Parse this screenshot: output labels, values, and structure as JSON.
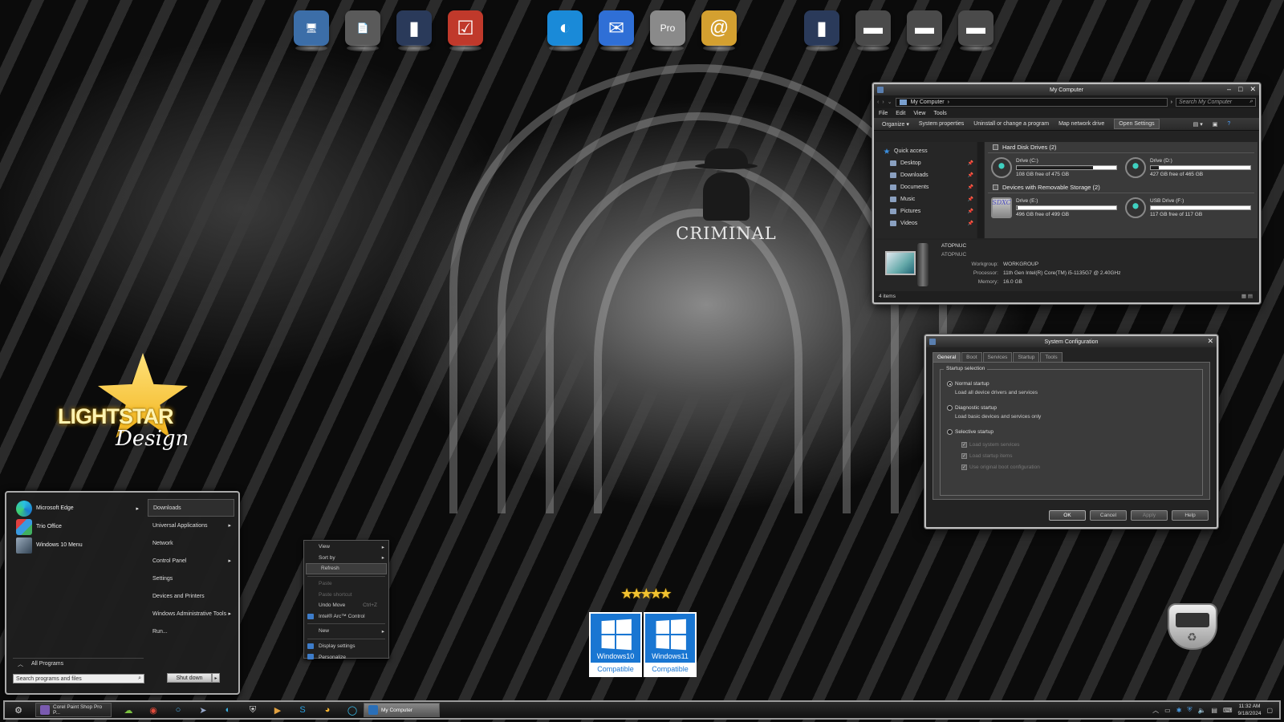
{
  "wallpaper": {
    "center_logo_text": "CRIMINAL",
    "brand_line1": "LIGHTSTAR",
    "brand_line2": "Design"
  },
  "dock": {
    "icons": [
      {
        "name": "my-computer-icon",
        "glyph": "🖥",
        "color": "#3c6ea8"
      },
      {
        "name": "documents-icon",
        "glyph": "📄",
        "color": "#5a5a5a"
      },
      {
        "name": "system-tower-icon",
        "glyph": "▮",
        "color": "#2a3a5a"
      },
      {
        "name": "checklist-icon",
        "glyph": "☑",
        "color": "#c0392b"
      },
      {
        "name": "edge-icon",
        "glyph": "◐",
        "color": "#1a8ad8"
      },
      {
        "name": "thunderbird-icon",
        "glyph": "✉",
        "color": "#2f6fd6"
      },
      {
        "name": "google-earth-pro-icon",
        "glyph": "Pro",
        "color": "#8a8a8a"
      },
      {
        "name": "address-book-icon",
        "glyph": "@",
        "color": "#d4a030"
      },
      {
        "name": "system-tower-2-icon",
        "glyph": "▮",
        "color": "#2a3a5a"
      },
      {
        "name": "folder-icon",
        "glyph": "▬",
        "color": "#4a4a4a"
      },
      {
        "name": "folder-2-icon",
        "glyph": "▬",
        "color": "#4a4a4a"
      },
      {
        "name": "folder-3-icon",
        "glyph": "▬",
        "color": "#4a4a4a"
      }
    ]
  },
  "mycomputer": {
    "title": "My Computer",
    "address": "My Computer",
    "search_placeholder": "Search My Computer",
    "menu": [
      "File",
      "Edit",
      "View",
      "Tools"
    ],
    "commands": [
      "Organize",
      "System properties",
      "Uninstall or change a program",
      "Map network drive",
      "Open Settings"
    ],
    "nav": {
      "quick_access": "Quick access",
      "items": [
        "Desktop",
        "Downloads",
        "Documents",
        "Music",
        "Pictures",
        "Videos"
      ]
    },
    "groups": {
      "hdd": "Hard Disk Drives (2)",
      "removable": "Devices with Removable Storage (2)"
    },
    "drives": [
      {
        "name": "Drive (C:)",
        "info": "108 GB free of 475 GB",
        "used": 0.77
      },
      {
        "name": "Drive (D:)",
        "info": "427 GB free of 465 GB",
        "used": 0.08
      },
      {
        "name": "Drive (E:)",
        "info": "496 GB free of 499 GB",
        "used": 0.01,
        "badge": "SDXC"
      },
      {
        "name": "USB Drive (F:)",
        "info": "117 GB free of 117 GB",
        "used": 0.0
      }
    ],
    "details": {
      "name1": "ATOPNUC",
      "name2": "ATOPNUC",
      "workgroup_label": "Workgroup:",
      "workgroup": "WORKGROUP",
      "processor_label": "Processor:",
      "processor": "11th Gen Intel(R) Core(TM) i5-1135G7 @ 2.40GHz",
      "memory_label": "Memory:",
      "memory": "16.0 GB"
    },
    "status": "4 items"
  },
  "msconfig": {
    "title": "System Configuration",
    "tabs": [
      "General",
      "Boot",
      "Services",
      "Startup",
      "Tools"
    ],
    "legend": "Startup selection",
    "normal": "Normal startup",
    "normal_desc": "Load all device drivers and services",
    "diagnostic": "Diagnostic startup",
    "diagnostic_desc": "Load basic devices and services only",
    "selective": "Selective startup",
    "checks": [
      "Load system services",
      "Load startup items",
      "Use original boot configuration"
    ],
    "buttons": {
      "ok": "OK",
      "cancel": "Cancel",
      "apply": "Apply",
      "help": "Help"
    }
  },
  "startmenu": {
    "programs": [
      "Microsoft Edge",
      "Trio Office",
      "Windows 10 Menu"
    ],
    "links": [
      "Downloads",
      "Universal Applications",
      "Network",
      "Control Panel",
      "Settings",
      "Devices and Printers",
      "Windows Administrative Tools",
      "Run..."
    ],
    "all_programs": "All Programs",
    "search_placeholder": "Search programs and files",
    "shutdown": "Shut down"
  },
  "contextmenu": {
    "view": "View",
    "sort_by": "Sort by",
    "refresh": "Refresh",
    "paste": "Paste",
    "paste_shortcut": "Paste shortcut",
    "undo_move": "Undo Move",
    "undo_shortcut": "Ctrl+Z",
    "intel_arc": "Intel® Arc™ Control",
    "new": "New",
    "display_settings": "Display settings",
    "personalize": "Personalize"
  },
  "badges": {
    "win10": {
      "name": "Windows10",
      "label": "Compatible"
    },
    "win11": {
      "name": "Windows11",
      "label": "Compatible"
    }
  },
  "taskbar": {
    "app1": "Corel Paint Shop Pro P...",
    "active_window": "My Computer",
    "time": "11:32 AM",
    "date": "9/18/2024"
  }
}
